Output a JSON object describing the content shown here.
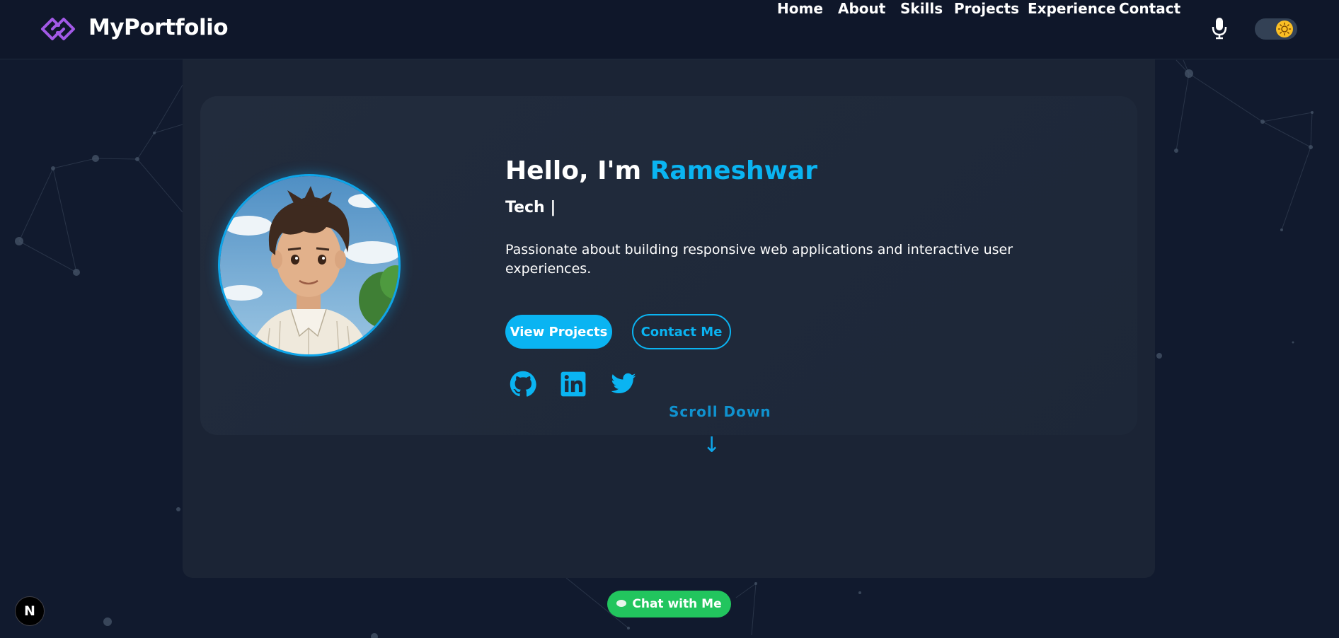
{
  "navbar": {
    "brand": "MyPortfolio",
    "links": [
      "Home",
      "About",
      "Skills",
      "Projects",
      "Experience",
      "Contact"
    ],
    "icons": {
      "logo": "diamond-link-logo-icon",
      "voice": "microphone-icon",
      "theme": "sun-icon"
    }
  },
  "hero": {
    "greeting_prefix": "Hello, I'm",
    "name": "Rameshwar",
    "role": "Tech |",
    "bio": "Passionate about building responsive web applications and interactive user experiences.",
    "primary_button": "View Projects",
    "secondary_button": "Contact Me",
    "socials": [
      "github-icon",
      "linkedin-icon",
      "twitter-icon"
    ],
    "scroll_label": "Scroll Down",
    "scroll_arrow": "↓"
  },
  "chat_button": "Chat with Me",
  "dev_badge": "N",
  "colors": {
    "accent": "#0ab4f2",
    "background": "#111a2e",
    "navbar": "#0f172a",
    "card": "#222c3d",
    "logo": "#a259e6",
    "chat": "#22c55e"
  }
}
